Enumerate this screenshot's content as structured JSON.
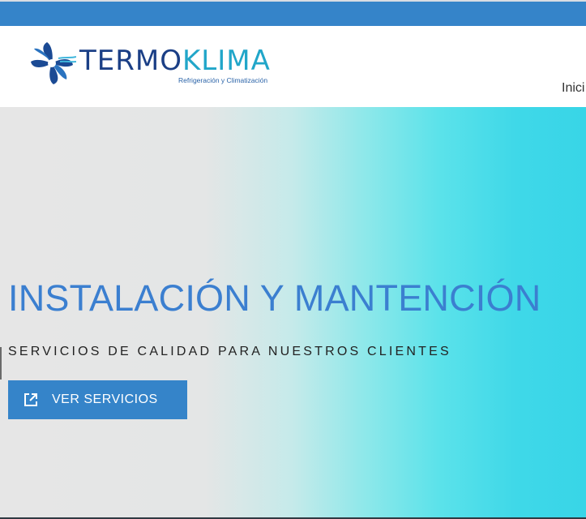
{
  "brand": {
    "name_part1": "TERMO",
    "name_part2": "KLIMA",
    "tagline": "Refrigeración y Climatización",
    "logo_icon": "fan-icon",
    "colors": {
      "dark_blue": "#1b3f86",
      "light_blue": "#21a6c9"
    }
  },
  "nav": {
    "items": [
      {
        "label": "Inici"
      }
    ]
  },
  "hero": {
    "title": "INSTALACIÓN Y MANTENCIÓN",
    "subtitle": "SERVICIOS DE CALIDAD PARA NUESTROS CLIENTES",
    "button": {
      "label": "VER SERVICIOS",
      "icon": "external-link-icon"
    }
  },
  "colors": {
    "topbar": "#3584c9",
    "accent": "#3584c9",
    "title": "#3b7fd0"
  }
}
